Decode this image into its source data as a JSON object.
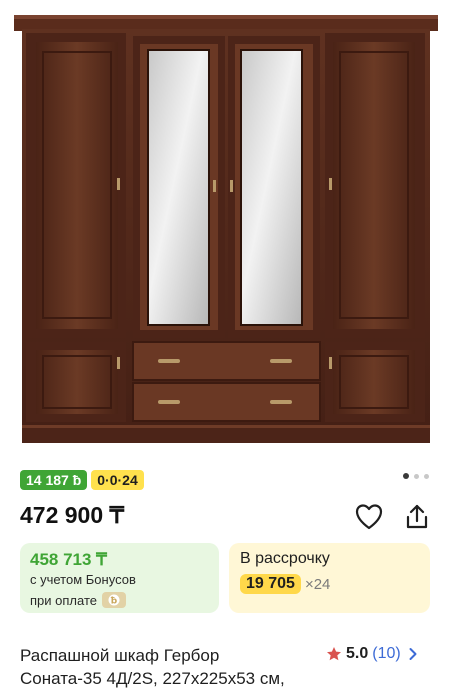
{
  "product": {
    "image_alt": "Шкаф",
    "gallery_dots": 3,
    "badges": {
      "bonus": "14 187 ƀ",
      "installment": "0·0·24"
    },
    "price": "472 900 ₸",
    "bonus_card": {
      "price": "458 713 ₸",
      "line1": "с учетом Бонусов",
      "line2": "при оплате"
    },
    "installment_card": {
      "title": "В рассрочку",
      "amount": "19 705",
      "months": "×24"
    },
    "title_line1": "Распашной шкаф Гербор",
    "title_line2": "Соната-35 4Д/2S, 227x225x53 см,",
    "rating": {
      "value": "5.0",
      "count": "(10)"
    }
  },
  "colors": {
    "green": "#3fa535",
    "yellow": "#ffe14d",
    "link_blue": "#3d6bd6",
    "star_red": "#d9534f",
    "wood": "#5a2e1c"
  },
  "icons": [
    "heart-icon",
    "share-icon",
    "star-icon",
    "chevron-right-icon",
    "bonus-chip-icon"
  ]
}
